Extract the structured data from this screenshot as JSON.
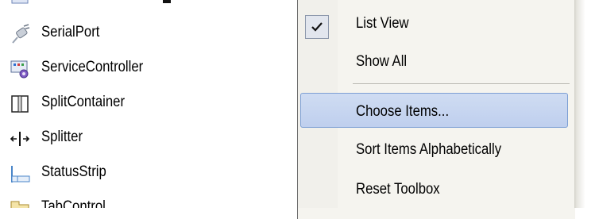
{
  "toolbox": {
    "items": [
      {
        "label": "",
        "icon": "toolbox-icon"
      },
      {
        "label": "SerialPort",
        "icon": "serial-port-icon"
      },
      {
        "label": "ServiceController",
        "icon": "service-controller-icon"
      },
      {
        "label": "SplitContainer",
        "icon": "split-container-icon"
      },
      {
        "label": "Splitter",
        "icon": "splitter-icon"
      },
      {
        "label": "StatusStrip",
        "icon": "status-strip-icon"
      },
      {
        "label": "TabControl",
        "icon": "tab-control-icon"
      }
    ]
  },
  "context_menu": {
    "items": [
      {
        "label": "List View",
        "checked": true
      },
      {
        "label": "Show All"
      },
      {
        "label": "Choose Items...",
        "highlighted": true
      },
      {
        "label": "Sort Items Alphabetically"
      },
      {
        "label": "Reset Toolbox"
      }
    ]
  },
  "colors": {
    "highlight": "#c6d6f0",
    "highlight_border": "#7d9fd4",
    "menu_background": "#f5f4ef"
  }
}
